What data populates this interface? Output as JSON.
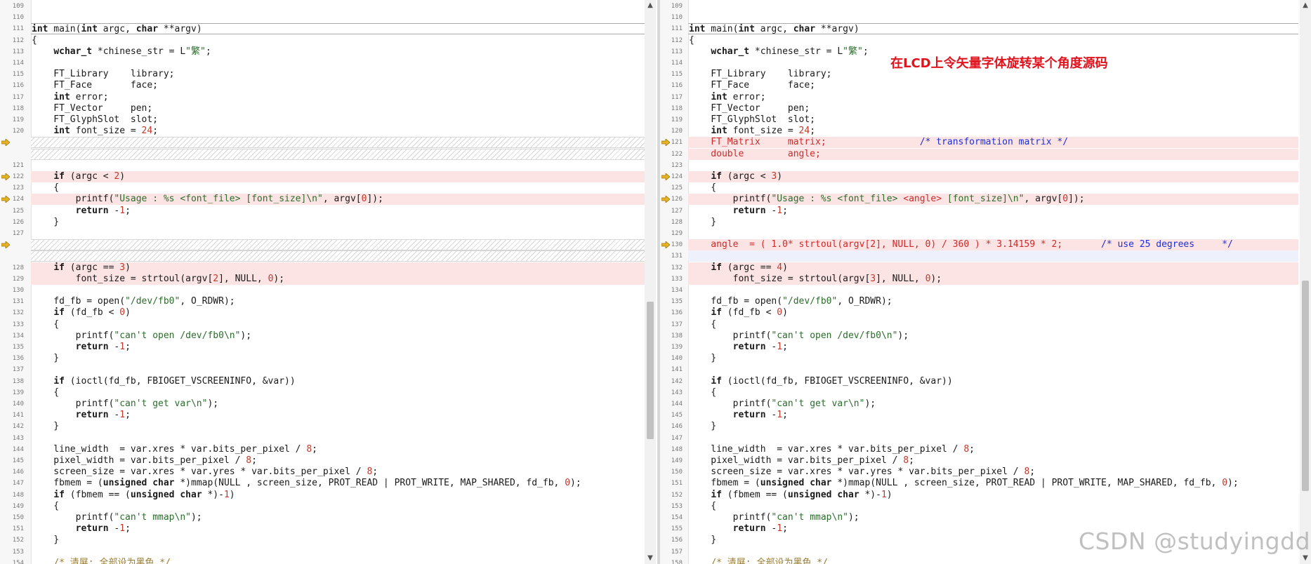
{
  "annotation": "在LCD上令矢量字体旋转某个角度源码",
  "watermark": "CSDN @studyingdda",
  "left": {
    "lines": [
      {
        "n": "109",
        "t": ""
      },
      {
        "n": "110",
        "t": ""
      },
      {
        "n": "111",
        "t": "int main(int argc, char **argv)",
        "cur": true
      },
      {
        "n": "112",
        "t": "{"
      },
      {
        "n": "113",
        "t": "    wchar_t *chinese_str = L\"繁\";"
      },
      {
        "n": "114",
        "t": ""
      },
      {
        "n": "115",
        "t": "    FT_Library    library;"
      },
      {
        "n": "116",
        "t": "    FT_Face       face;"
      },
      {
        "n": "117",
        "t": "    int error;"
      },
      {
        "n": "118",
        "t": "    FT_Vector     pen;"
      },
      {
        "n": "119",
        "t": "    FT_GlyphSlot  slot;"
      },
      {
        "n": "120",
        "t": "    int font_size = 24;"
      },
      {
        "n": "",
        "t": "",
        "h": true,
        "a": true
      },
      {
        "n": "",
        "t": "",
        "h": true
      },
      {
        "n": "121",
        "t": ""
      },
      {
        "n": "122",
        "t": "    if (argc < 2)",
        "c": true,
        "a": true
      },
      {
        "n": "123",
        "t": "    {"
      },
      {
        "n": "124",
        "t": "        printf(\"Usage : %s <font_file> [font_size]\\n\", argv[0]);",
        "c": true,
        "a": true
      },
      {
        "n": "125",
        "t": "        return -1;"
      },
      {
        "n": "126",
        "t": "    }"
      },
      {
        "n": "127",
        "t": ""
      },
      {
        "n": "",
        "t": "",
        "h": true,
        "a": true
      },
      {
        "n": "",
        "t": "",
        "h": true
      },
      {
        "n": "128",
        "t": "    if (argc == 3)",
        "c": true
      },
      {
        "n": "129",
        "t": "        font_size = strtoul(argv[2], NULL, 0);",
        "c": true
      },
      {
        "n": "130",
        "t": ""
      },
      {
        "n": "131",
        "t": "    fd_fb = open(\"/dev/fb0\", O_RDWR);"
      },
      {
        "n": "132",
        "t": "    if (fd_fb < 0)"
      },
      {
        "n": "133",
        "t": "    {"
      },
      {
        "n": "134",
        "t": "        printf(\"can't open /dev/fb0\\n\");"
      },
      {
        "n": "135",
        "t": "        return -1;"
      },
      {
        "n": "136",
        "t": "    }"
      },
      {
        "n": "137",
        "t": ""
      },
      {
        "n": "138",
        "t": "    if (ioctl(fd_fb, FBIOGET_VSCREENINFO, &var))"
      },
      {
        "n": "139",
        "t": "    {"
      },
      {
        "n": "140",
        "t": "        printf(\"can't get var\\n\");"
      },
      {
        "n": "141",
        "t": "        return -1;"
      },
      {
        "n": "142",
        "t": "    }"
      },
      {
        "n": "143",
        "t": ""
      },
      {
        "n": "144",
        "t": "    line_width  = var.xres * var.bits_per_pixel / 8;"
      },
      {
        "n": "145",
        "t": "    pixel_width = var.bits_per_pixel / 8;"
      },
      {
        "n": "146",
        "t": "    screen_size = var.xres * var.yres * var.bits_per_pixel / 8;"
      },
      {
        "n": "147",
        "t": "    fbmem = (unsigned char *)mmap(NULL , screen_size, PROT_READ | PROT_WRITE, MAP_SHARED, fd_fb, 0);"
      },
      {
        "n": "148",
        "t": "    if (fbmem == (unsigned char *)-1)"
      },
      {
        "n": "149",
        "t": "    {"
      },
      {
        "n": "150",
        "t": "        printf(\"can't mmap\\n\");"
      },
      {
        "n": "151",
        "t": "        return -1;"
      },
      {
        "n": "152",
        "t": "    }"
      },
      {
        "n": "153",
        "t": ""
      },
      {
        "n": "154",
        "t": "    /* 清屏: 全部设为黑色 */"
      }
    ]
  },
  "right": {
    "lines": [
      {
        "n": "109",
        "t": ""
      },
      {
        "n": "110",
        "t": ""
      },
      {
        "n": "111",
        "t": "int main(int argc, char **argv)",
        "cur": true
      },
      {
        "n": "112",
        "t": "{"
      },
      {
        "n": "113",
        "t": "    wchar_t *chinese_str = L\"繁\";"
      },
      {
        "n": "114",
        "t": ""
      },
      {
        "n": "115",
        "t": "    FT_Library    library;"
      },
      {
        "n": "116",
        "t": "    FT_Face       face;"
      },
      {
        "n": "117",
        "t": "    int error;"
      },
      {
        "n": "118",
        "t": "    FT_Vector     pen;"
      },
      {
        "n": "119",
        "t": "    FT_GlyphSlot  slot;"
      },
      {
        "n": "120",
        "t": "    int font_size = 24;"
      },
      {
        "n": "121",
        "t": "    FT_Matrix     matrix;                 /* transformation matrix */",
        "c": true,
        "a": true,
        "red": true
      },
      {
        "n": "122",
        "t": "    double        angle;",
        "c": true,
        "red": true
      },
      {
        "n": "123",
        "t": ""
      },
      {
        "n": "124",
        "t": "    if (argc < 3)",
        "c": true,
        "a": true
      },
      {
        "n": "125",
        "t": "    {"
      },
      {
        "n": "126",
        "t": "        printf(\"Usage : %s <font_file> <angle> [font_size]\\n\", argv[0]);",
        "c": true,
        "a": true
      },
      {
        "n": "127",
        "t": "        return -1;"
      },
      {
        "n": "128",
        "t": "    }"
      },
      {
        "n": "129",
        "t": ""
      },
      {
        "n": "130",
        "t": "    angle  = ( 1.0* strtoul(argv[2], NULL, 0) / 360 ) * 3.14159 * 2;       /* use 25 degrees     */",
        "c": true,
        "a": true,
        "red": true
      },
      {
        "n": "131",
        "t": "",
        "b": true
      },
      {
        "n": "132",
        "t": "    if (argc == 4)",
        "c": true
      },
      {
        "n": "133",
        "t": "        font_size = strtoul(argv[3], NULL, 0);",
        "c": true
      },
      {
        "n": "134",
        "t": ""
      },
      {
        "n": "135",
        "t": "    fd_fb = open(\"/dev/fb0\", O_RDWR);"
      },
      {
        "n": "136",
        "t": "    if (fd_fb < 0)"
      },
      {
        "n": "137",
        "t": "    {"
      },
      {
        "n": "138",
        "t": "        printf(\"can't open /dev/fb0\\n\");"
      },
      {
        "n": "139",
        "t": "        return -1;"
      },
      {
        "n": "140",
        "t": "    }"
      },
      {
        "n": "141",
        "t": ""
      },
      {
        "n": "142",
        "t": "    if (ioctl(fd_fb, FBIOGET_VSCREENINFO, &var))"
      },
      {
        "n": "143",
        "t": "    {"
      },
      {
        "n": "144",
        "t": "        printf(\"can't get var\\n\");"
      },
      {
        "n": "145",
        "t": "        return -1;"
      },
      {
        "n": "146",
        "t": "    }"
      },
      {
        "n": "147",
        "t": ""
      },
      {
        "n": "148",
        "t": "    line_width  = var.xres * var.bits_per_pixel / 8;"
      },
      {
        "n": "149",
        "t": "    pixel_width = var.bits_per_pixel / 8;"
      },
      {
        "n": "150",
        "t": "    screen_size = var.xres * var.yres * var.bits_per_pixel / 8;"
      },
      {
        "n": "151",
        "t": "    fbmem = (unsigned char *)mmap(NULL , screen_size, PROT_READ | PROT_WRITE, MAP_SHARED, fd_fb, 0);"
      },
      {
        "n": "152",
        "t": "    if (fbmem == (unsigned char *)-1)"
      },
      {
        "n": "153",
        "t": "    {"
      },
      {
        "n": "154",
        "t": "        printf(\"can't mmap\\n\");"
      },
      {
        "n": "155",
        "t": "        return -1;"
      },
      {
        "n": "156",
        "t": "    }"
      },
      {
        "n": "157",
        "t": ""
      },
      {
        "n": "158",
        "t": "    /* 清屏: 全部设为黑色 */"
      }
    ]
  },
  "icons": {
    "diff_marker": "diff-arrow-icon",
    "scroll_up": "scroll-up-arrow-icon",
    "scroll_down": "scroll-down-arrow-icon"
  },
  "colors": {
    "changed_line_bg": "#fde4e4",
    "changed_text": "#cc2b2b",
    "comment_blue": "#1c2fd8",
    "string": "#2a6e2a",
    "number": "#c0392b",
    "diff_arrow": "#e6b422",
    "annotation": "#e0141e"
  }
}
